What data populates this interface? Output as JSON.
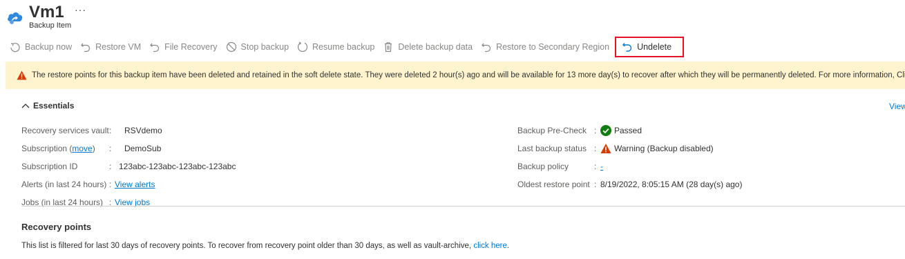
{
  "header": {
    "title": "Vm1",
    "more": "···",
    "subtitle": "Backup Item",
    "icon": "backup-cloud-icon",
    "brand_color": "#0078d4"
  },
  "toolbar": {
    "items": [
      {
        "label": "Backup now",
        "icon": "backup-now-icon",
        "enabled": false
      },
      {
        "label": "Restore VM",
        "icon": "restore-icon",
        "enabled": false
      },
      {
        "label": "File Recovery",
        "icon": "restore-icon",
        "enabled": false
      },
      {
        "label": "Stop backup",
        "icon": "stop-icon",
        "enabled": false
      },
      {
        "label": "Resume backup",
        "icon": "resume-icon",
        "enabled": false
      },
      {
        "label": "Delete backup data",
        "icon": "trash-icon",
        "enabled": false
      },
      {
        "label": "Restore to Secondary Region",
        "icon": "restore-icon",
        "enabled": false
      },
      {
        "label": "Undelete",
        "icon": "undelete-icon",
        "enabled": true,
        "highlighted": true
      }
    ],
    "highlight_color": "#e81123"
  },
  "banner": {
    "text": "The restore points for this backup item have been deleted and retained in the soft delete state. They were deleted 2 hour(s) ago and will be available for 13 more day(s) to recover after which they will be permanently deleted. For more information, Click here.",
    "arrow": "→",
    "icon": "warning-icon",
    "background": "#fff4ce"
  },
  "essentials": {
    "heading": "Essentials",
    "view_link": "View",
    "left": {
      "vault_label": "Recovery services vault",
      "vault_value": "RSVdemo",
      "subscription_label_prefix": "Subscription (",
      "subscription_move_link": "move",
      "subscription_label_suffix": ")",
      "subscription_value": "DemoSub",
      "subscription_id_label": "Subscription ID",
      "subscription_id_value": "123abc-123abc-123abc-123abc",
      "alerts_label": "Alerts (in last 24 hours)",
      "alerts_link": "View alerts",
      "jobs_label": "Jobs (in last 24 hours)",
      "jobs_link": "View jobs"
    },
    "right": {
      "precheck_label": "Backup Pre-Check",
      "precheck_value": "Passed",
      "last_backup_label": "Last backup status",
      "last_backup_value": "Warning (Backup disabled)",
      "policy_label": "Backup policy",
      "policy_value": "-",
      "oldest_label": "Oldest restore point",
      "oldest_value": "8/19/2022, 8:05:15 AM (28 day(s) ago)"
    },
    "colon": ":"
  },
  "recovery_points": {
    "title": "Recovery points",
    "description": "This list is filtered for last 30 days of recovery points. To recover from recovery point older than 30 days, as well as vault-archive,",
    "link": "click here",
    "suffix": "."
  },
  "colors": {
    "link": "#0078d4",
    "success": "#107c10",
    "warning": "#d83b01"
  }
}
